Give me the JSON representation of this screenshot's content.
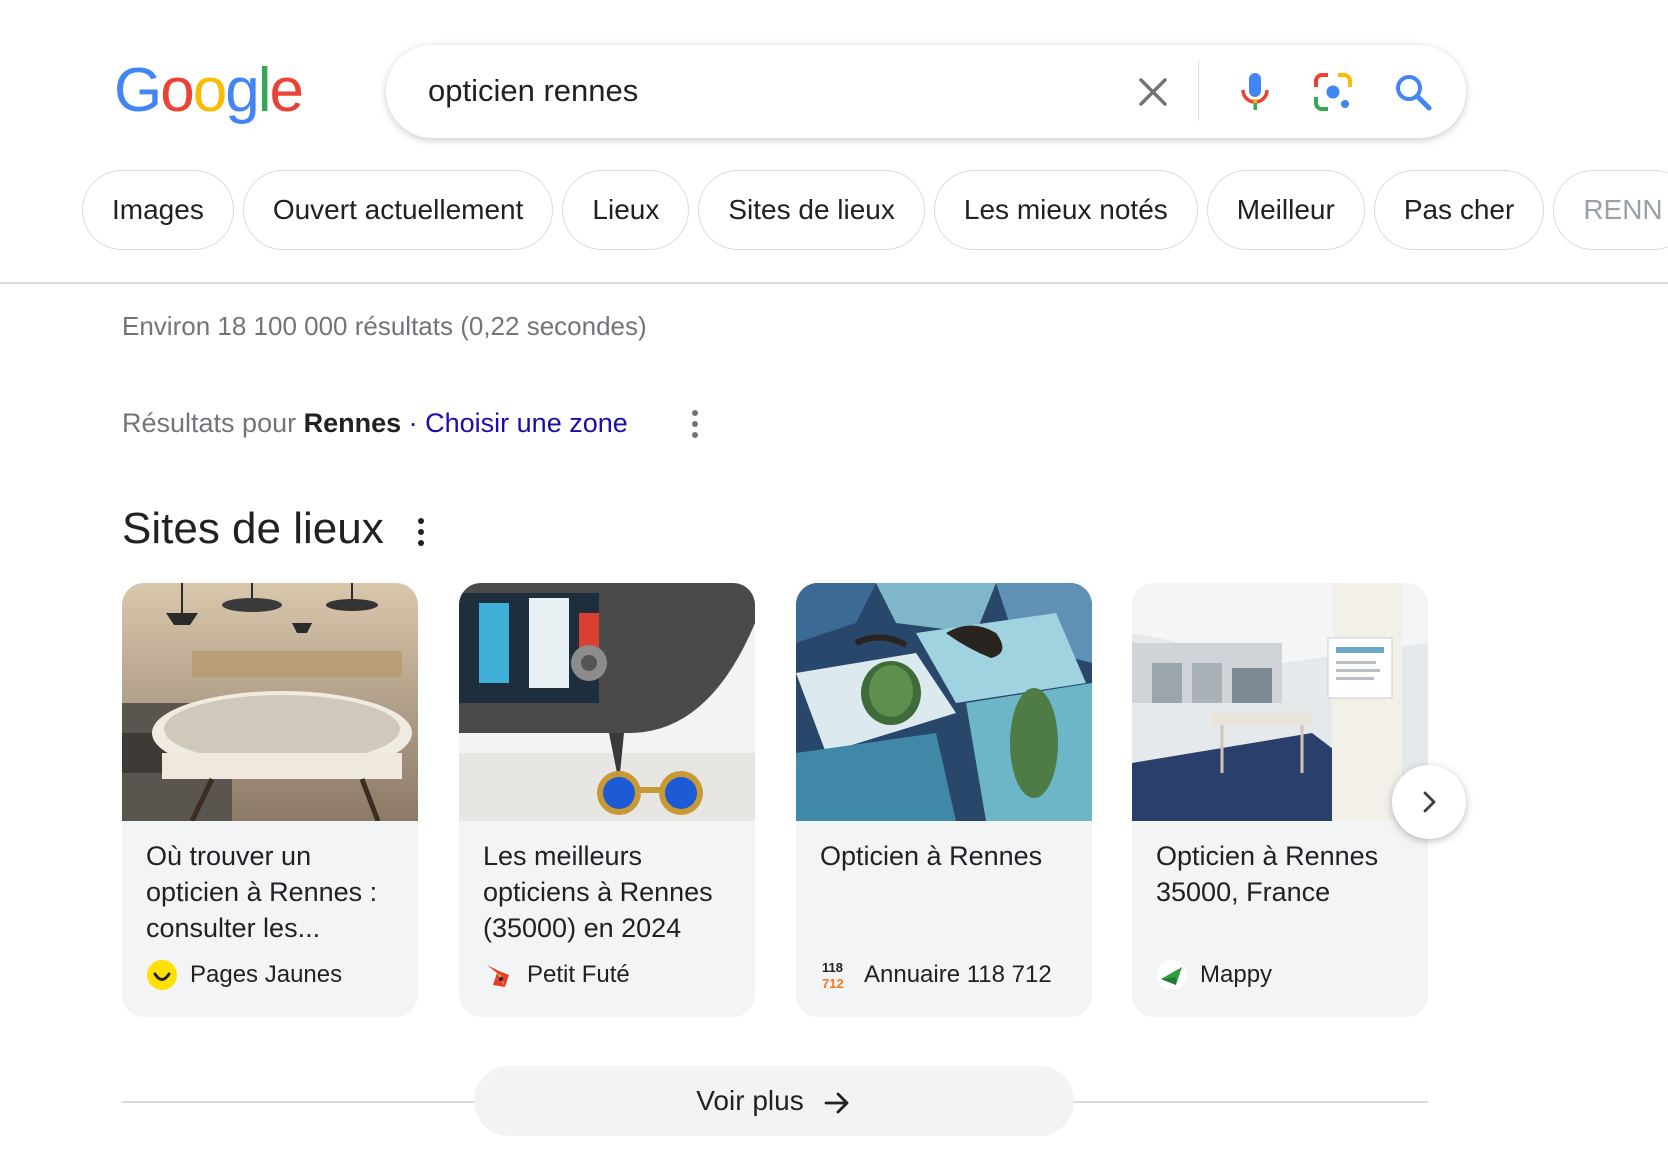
{
  "logo": {
    "letters": [
      "G",
      "o",
      "o",
      "g",
      "l",
      "e"
    ],
    "colors": [
      "#4285F4",
      "#EA4335",
      "#FBBC05",
      "#4285F4",
      "#34A853",
      "#EA4335"
    ]
  },
  "search": {
    "query": "opticien rennes",
    "icons": [
      "close-icon",
      "microphone-icon",
      "lens-icon",
      "search-icon"
    ]
  },
  "chips": [
    "Images",
    "Ouvert actuellement",
    "Lieux",
    "Sites de lieux",
    "Les mieux notés",
    "Meilleur",
    "Pas cher",
    "RENN"
  ],
  "stats": "Environ 18 100 000 résultats (0,22 secondes)",
  "location": {
    "prefix": "Résultats pour ",
    "city": "Rennes",
    "separator": " · ",
    "link": "Choisir une zone"
  },
  "section": {
    "title": "Sites de lieux"
  },
  "cards": [
    {
      "title": "Où trouver un opticien à Rennes : consulter les...",
      "source": "Pages Jaunes",
      "icon": "smiley-icon"
    },
    {
      "title": "Les meilleurs opticiens à Rennes (35000) en 2024",
      "source": "Petit Futé",
      "icon": "fox-icon"
    },
    {
      "title": "Opticien à Rennes",
      "source": "Annuaire 118 712",
      "icon": "annuaire-icon",
      "icon_text": [
        "118",
        "712"
      ]
    },
    {
      "title": "Opticien à Rennes 35000, France",
      "source": "Mappy",
      "icon": "mappy-icon"
    }
  ],
  "more_button": "Voir plus",
  "colors": {
    "link": "#1a0dab",
    "secondary_text": "#70757a",
    "border": "#dadce0",
    "card_bg": "#f3f4f6"
  }
}
